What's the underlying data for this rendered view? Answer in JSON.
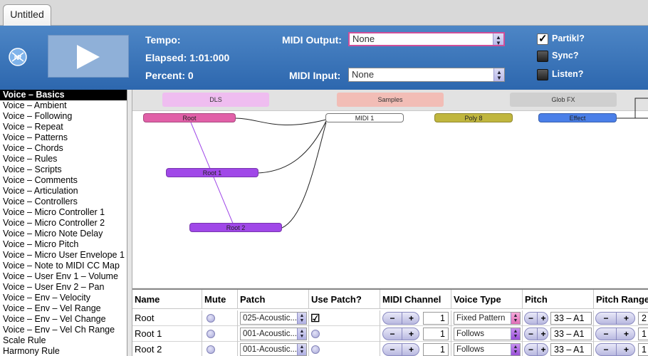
{
  "tabs": [
    {
      "label": "Untitled"
    }
  ],
  "header": {
    "tempo_label": "Tempo:",
    "elapsed_label": "Elapsed: 1:01:000",
    "percent_label": "Percent: 0",
    "midi_output_label": "MIDI Output:",
    "midi_output_value": "None",
    "midi_input_label": "MIDI Input:",
    "midi_input_value": "None",
    "partikl_label": "Partikl?",
    "partikl_checked": true,
    "sync_label": "Sync?",
    "listen_label": "Listen?"
  },
  "sidebar": {
    "items": [
      "Voice – Basics",
      "Voice – Ambient",
      "Voice – Following",
      "Voice – Repeat",
      "Voice – Patterns",
      "Voice – Chords",
      "Voice – Rules",
      "Voice – Scripts",
      "Voice – Comments",
      "Voice – Articulation",
      "Voice – Controllers",
      "Voice – Micro Controller 1",
      "Voice – Micro Controller 2",
      "Voice – Micro Note Delay",
      "Voice – Micro Pitch",
      "Voice – Micro User Envelope 1",
      "Voice – Note to MIDI CC Map",
      "Voice – User Env 1 – Volume",
      "Voice – User Env 2 – Pan",
      "Voice – Env – Velocity",
      "Voice – Env – Vel Range",
      "Voice – Env – Vel Change",
      "Voice – Env – Vel Ch Range",
      "Scale Rule",
      "Harmony Rule"
    ],
    "selected_index": 0
  },
  "graph": {
    "buses": [
      {
        "label": "DLS",
        "color": "#efbdf0"
      },
      {
        "label": "Samples",
        "color": "#f2bdb6"
      },
      {
        "label": "Glob FX",
        "color": "#cfcfcf"
      }
    ],
    "nodes": {
      "root": {
        "label": "Root",
        "color": "#e160a8"
      },
      "root1": {
        "label": "Root 1",
        "color": "#a048e8"
      },
      "root2": {
        "label": "Root 2",
        "color": "#a048e8"
      },
      "midi1": {
        "label": "MIDI 1",
        "color": "#ffffff"
      },
      "poly8": {
        "label": "Poly 8",
        "color": "#c0b63e"
      },
      "effect": {
        "label": "Effect",
        "color": "#4a7fe8"
      }
    }
  },
  "table": {
    "columns": [
      "Name",
      "Mute",
      "Patch",
      "Use Patch?",
      "MIDI Channel",
      "Voice Type",
      "Pitch",
      "Pitch Range"
    ],
    "rows": [
      {
        "name": "Root",
        "patch": "025-Acoustic...",
        "use_patch": true,
        "midi_channel": "1",
        "voice_type": "Fixed Pattern",
        "pitch": "33 – A1",
        "pitch_range": "2"
      },
      {
        "name": "Root 1",
        "patch": "001-Acoustic...",
        "use_patch": false,
        "midi_channel": "1",
        "voice_type": "Follows",
        "pitch": "33 – A1",
        "pitch_range": "1"
      },
      {
        "name": "Root 2",
        "patch": "001-Acoustic...",
        "use_patch": false,
        "midi_channel": "1",
        "voice_type": "Follows",
        "pitch": "33 – A1",
        "pitch_range": "1"
      }
    ],
    "stepper_minus": "−",
    "stepper_plus": "+"
  },
  "colors": {
    "header_blue": "#2d67ae",
    "play_button": "#8fb0d8",
    "focus_ring": "#cf4f9a"
  }
}
